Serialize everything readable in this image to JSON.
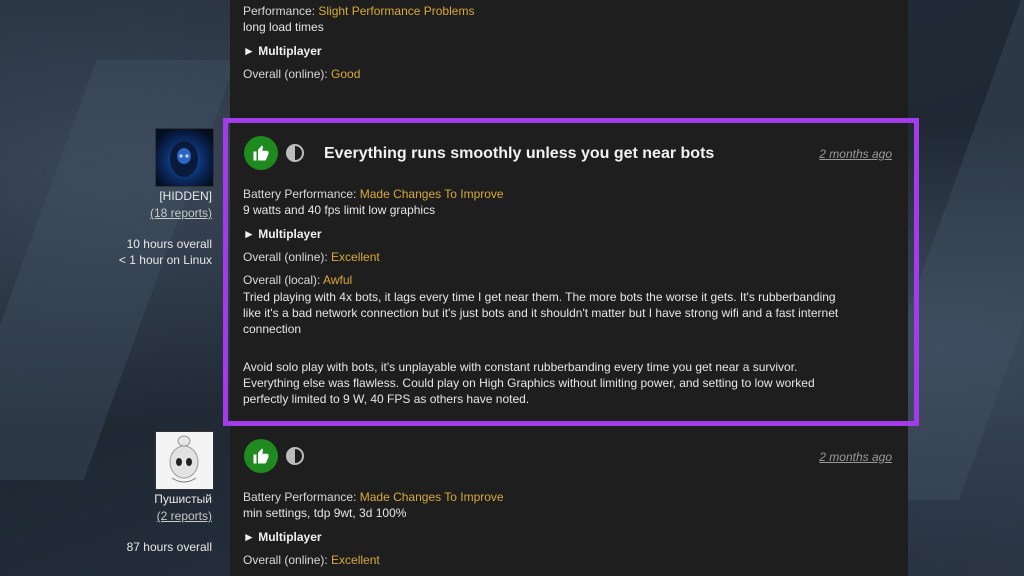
{
  "top_report": {
    "performance_label": "Performance:",
    "performance_value": "Slight Performance Problems",
    "note": "long load times",
    "multiplayer_toggle": "► Multiplayer",
    "overall_online_label": "Overall (online):",
    "overall_online_value": "Good"
  },
  "report1": {
    "user_name": "[HIDDEN]",
    "user_reports": "(18 reports)",
    "hours_overall": "10 hours overall",
    "hours_linux": "< 1 hour on Linux",
    "title": "Everything runs smoothly unless you get near bots",
    "date": "2 months ago",
    "battery_label": "Battery Performance:",
    "battery_value": "Made Changes To Improve",
    "battery_note": "9 watts and 40 fps limit low graphics",
    "multiplayer_toggle": "► Multiplayer",
    "overall_online_label": "Overall (online):",
    "overall_online_value": "Excellent",
    "overall_local_label": "Overall (local):",
    "overall_local_value": "Awful",
    "local_note": "Tried playing with 4x bots, it lags every time I get near them. The more bots the worse it gets. It's rubberbanding like it's a bad network connection but it's just bots and it shouldn't matter but I have strong wifi and a fast internet connection",
    "summary": "Avoid solo play with bots, it's unplayable with constant rubberbanding every time you get near a survivor. Everything else was flawless. Could play on High Graphics without limiting power, and setting to low worked perfectly limited to 9 W, 40 FPS as others have noted."
  },
  "report2": {
    "user_name": "Пушистый",
    "user_reports": "(2 reports)",
    "hours_overall": "87 hours overall",
    "date": "2 months ago",
    "battery_label": "Battery Performance:",
    "battery_value": "Made Changes To Improve",
    "battery_note": "min settings, tdp 9wt, 3d 100%",
    "multiplayer_toggle": "► Multiplayer",
    "overall_online_label": "Overall (online):",
    "overall_online_value": "Excellent"
  },
  "colors": {
    "accent_value": "#d6a93a",
    "highlight_border": "#a23be8",
    "thumb_green": "#1f8a1f"
  }
}
